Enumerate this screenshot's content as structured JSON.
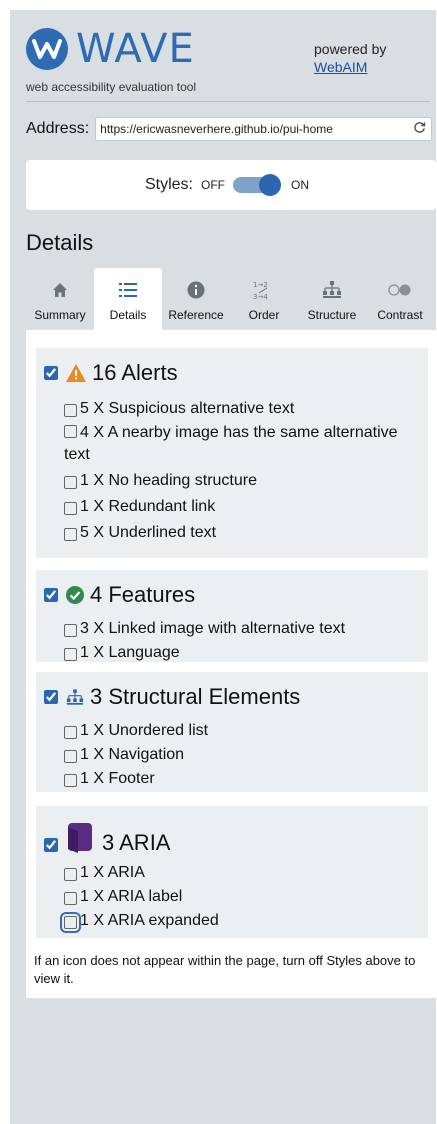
{
  "header": {
    "logo_text": "WAVE",
    "tagline": "web accessibility evaluation tool",
    "powered_by": "powered by",
    "powered_link": "WebAIM"
  },
  "address": {
    "label": "Address:",
    "value": "https://ericwasneverhere.github.io/pui-home"
  },
  "styles": {
    "label": "Styles:",
    "off": "OFF",
    "on": "ON",
    "state": "on"
  },
  "details_heading": "Details",
  "tabs": [
    {
      "label": "Summary",
      "icon": "home-icon"
    },
    {
      "label": "Details",
      "icon": "list-icon",
      "active": true
    },
    {
      "label": "Reference",
      "icon": "info-icon"
    },
    {
      "label": "Order",
      "icon": "order-icon"
    },
    {
      "label": "Structure",
      "icon": "structure-icon"
    },
    {
      "label": "Contrast",
      "icon": "contrast-icon"
    }
  ],
  "groups": {
    "alerts": {
      "title": "16 Alerts",
      "items": [
        "5 X Suspicious alternative text",
        "4 X A nearby image has the same alternative text",
        "1 X No heading structure",
        "1 X Redundant link",
        "5 X Underlined text"
      ]
    },
    "features": {
      "title": "4 Features",
      "items": [
        "3 X Linked image with alternative text",
        "1 X Language"
      ]
    },
    "structure": {
      "title": "3 Structural Elements",
      "items": [
        "1 X Unordered list",
        "1 X Navigation",
        "1 X Footer"
      ]
    },
    "aria": {
      "title": "3 ARIA",
      "items": [
        "1 X ARIA",
        "1 X ARIA label",
        "1 X ARIA expanded"
      ]
    }
  },
  "note": "If an icon does not appear within the page, turn off Styles above to view it.",
  "colors": {
    "brand": "#2e6bb3",
    "alert": "#e88a1f",
    "feature": "#2f8a4b",
    "aria": "#5b2c86"
  }
}
